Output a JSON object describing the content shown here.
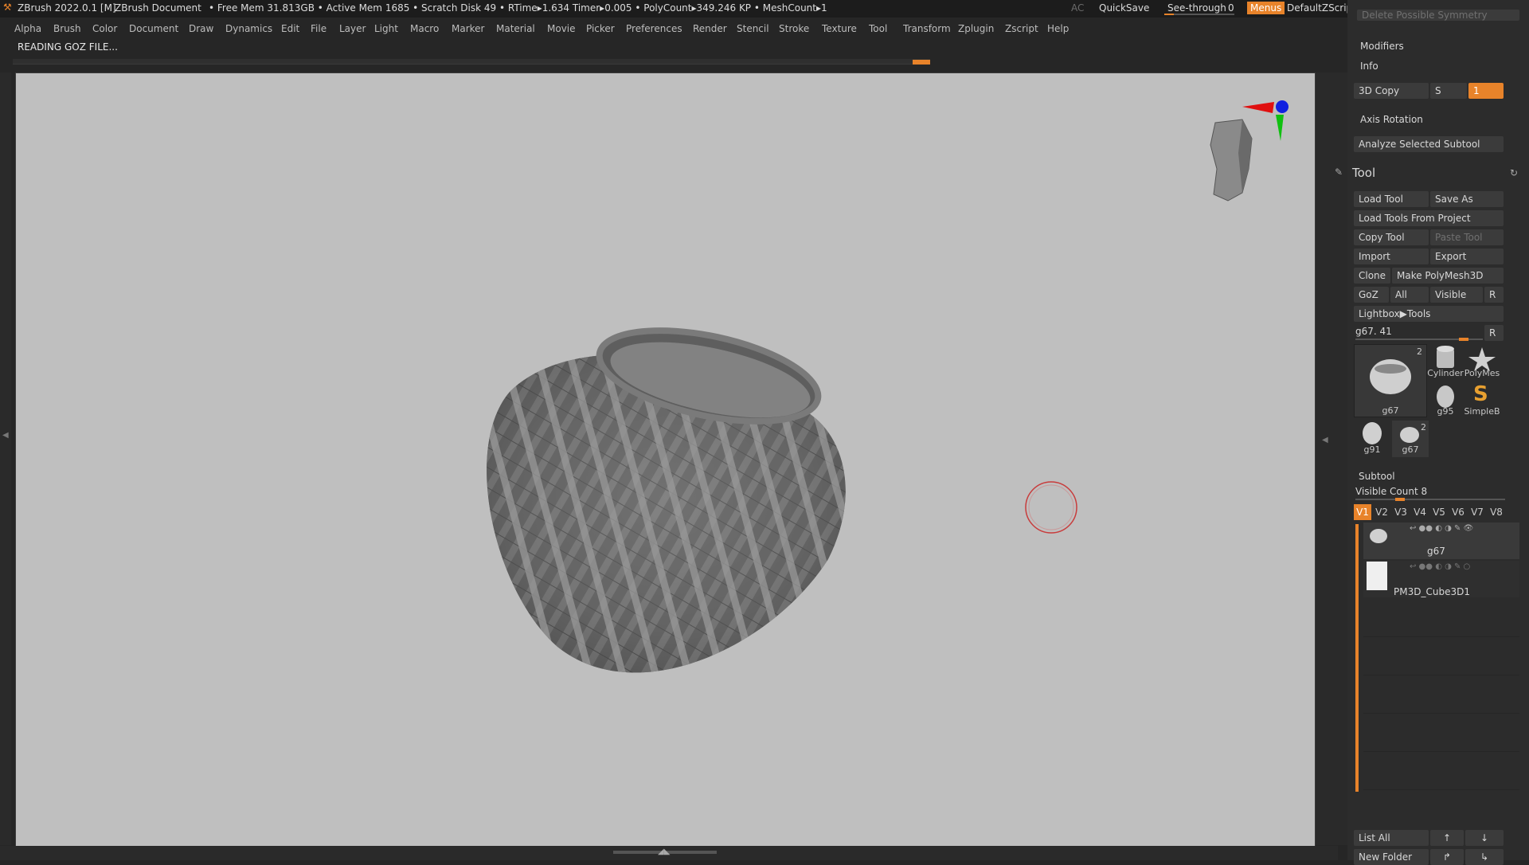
{
  "titlebar": {
    "app_title": "ZBrush 2022.0.1 [M]",
    "document": "ZBrush Document",
    "stats": "• Free Mem 31.813GB • Active Mem 1685 • Scratch Disk 49 •  RTime▸1.634 Timer▸0.005 • PolyCount▸349.246 KP  • MeshCount▸1",
    "ac": "AC",
    "quicksave": "QuickSave",
    "see_through_label": "See-through",
    "see_through_value": "0",
    "menus": "Menus",
    "default_zscript": "DefaultZScript"
  },
  "menubar": [
    "Alpha",
    "Brush",
    "Color",
    "Document",
    "Draw",
    "Dynamics",
    "Edit",
    "File",
    "Layer",
    "Light",
    "Macro",
    "Marker",
    "Material",
    "Movie",
    "Picker",
    "Preferences",
    "Render",
    "Stencil",
    "Stroke",
    "Texture",
    "Tool",
    "Transform",
    "Zplugin",
    "Zscript",
    "Help"
  ],
  "status": "READING GOZ FILE...",
  "panel": {
    "top_truncated": "Delete Possible Symmetry",
    "modifiers": "Modifiers",
    "info": "Info",
    "copy3d": "3D Copy",
    "copy3d_s": "S",
    "copy3d_value": "1",
    "axis_rotation": "Axis Rotation",
    "analyze": "Analyze Selected Subtool",
    "tool_title": "Tool",
    "load_tool": "Load Tool",
    "save_as": "Save As",
    "load_from_project": "Load Tools From Project",
    "copy_tool": "Copy Tool",
    "paste_tool": "Paste Tool",
    "import": "Import",
    "export": "Export",
    "clone": "Clone",
    "make_polymesh": "Make PolyMesh3D",
    "goz": "GoZ",
    "all": "All",
    "visible": "Visible",
    "r": "R",
    "lightbox_tools": "Lightbox▶Tools",
    "current_tool": "g67. 41",
    "thumbs": [
      {
        "name": "g67",
        "badge": "2"
      },
      {
        "name": "Cylinder",
        "badge": ""
      },
      {
        "name": "PolyMes",
        "badge": ""
      },
      {
        "name": "g95",
        "badge": ""
      },
      {
        "name": "SimpleB",
        "badge": ""
      },
      {
        "name": "g91",
        "badge": ""
      },
      {
        "name": "g67",
        "badge": "2"
      }
    ],
    "subtool": "Subtool",
    "visible_count": "Visible Count 8",
    "vtabs": [
      "V1",
      "V2",
      "V3",
      "V4",
      "V5",
      "V6",
      "V7",
      "V8"
    ],
    "subtools": [
      "g67",
      "PM3D_Cube3D1"
    ],
    "list_all": "List All",
    "new_folder": "New Folder"
  },
  "colors": {
    "accent": "#e8832a",
    "canvas": "#bfbfbf",
    "panel": "#2c2c2c"
  }
}
